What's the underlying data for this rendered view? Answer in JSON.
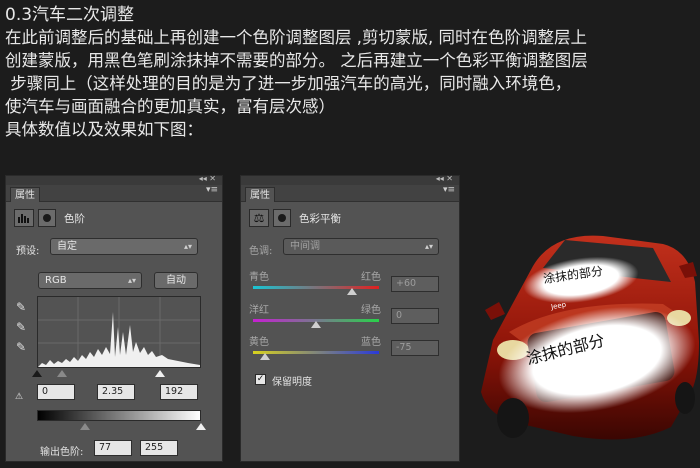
{
  "intro": {
    "title": "0.3汽车二次调整",
    "lines": [
      "在此前调整后的基础上再创建一个色阶调整图层 ,剪切蒙版, 同时在色阶调整层上",
      "创建蒙版，用黑色笔刷涂抹掉不需要的部分。 之后再建立一个色彩平衡调整图层",
      " 步骤同上（这样处理的目的是为了进一步加强汽车的高光，同时融入环境色，",
      "使汽车与画面融合的更加真实，富有层次感）",
      "具体数值以及效果如下图："
    ]
  },
  "levels_panel": {
    "tab": "属性",
    "header_name": "色阶",
    "preset_label": "预设:",
    "preset_value": "自定",
    "channel_value": "RGB",
    "auto_button": "自动",
    "input_black": "0",
    "input_gamma": "2.35",
    "input_white": "192",
    "output_label": "输出色阶:",
    "output_black": "77",
    "output_white": "255"
  },
  "color_balance_panel": {
    "tab": "属性",
    "header_name": "色彩平衡",
    "tone_label": "色调:",
    "tone_value": "中间调",
    "sliders": [
      {
        "left": "青色",
        "right": "红色",
        "value": "+60",
        "level": 60
      },
      {
        "left": "洋红",
        "right": "绿色",
        "value": "0",
        "level": 0
      },
      {
        "left": "黄色",
        "right": "蓝色",
        "value": "-75",
        "level": -75
      }
    ],
    "preserve_label": "保留明度",
    "preserve_checked": true
  },
  "car": {
    "blob_top_text": "涂抹的部分",
    "blob_front_text": "涂抹的部分",
    "badge_text": "Jeep"
  },
  "colors": {
    "panel_bg": "#535353",
    "page_bg": "#1c1c1c",
    "car_red": "#a0180c"
  }
}
